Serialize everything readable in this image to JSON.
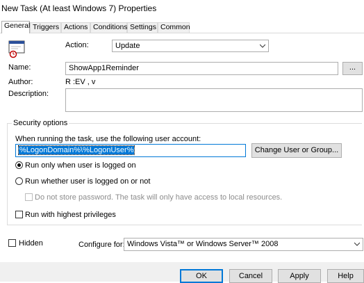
{
  "window": {
    "title": "New Task (At least Windows 7) Properties"
  },
  "tabs": [
    {
      "label": "General",
      "active": true
    },
    {
      "label": "Triggers"
    },
    {
      "label": "Actions"
    },
    {
      "label": "Conditions"
    },
    {
      "label": "Settings"
    },
    {
      "label": "Common"
    }
  ],
  "general": {
    "action_label": "Action:",
    "action_value": "Update",
    "name_label": "Name:",
    "name_value": "ShowApp1Reminder",
    "name_browse_label": "...",
    "author_label": "Author:",
    "author_value": "R          :EV     ,    v",
    "description_label": "Description:",
    "description_value": ""
  },
  "security": {
    "group_title": "Security options",
    "account_prompt": "When running the task, use the following user account:",
    "account_value": "%LogonDomain%\\%LogonUser%",
    "change_user_button": "Change User or Group...",
    "radio_logged_on": "Run only when user is logged on",
    "radio_logged_on_checked": true,
    "radio_whether": "Run whether user is logged on or not",
    "no_store_password": "Do not store password.  The task will only have access to local resources.",
    "highest_privileges": "Run with highest privileges"
  },
  "footer": {
    "hidden_label": "Hidden",
    "configure_label": "Configure for:",
    "configure_value": "Windows Vista™ or Windows Server™ 2008"
  },
  "buttons": {
    "ok": "OK",
    "cancel": "Cancel",
    "apply": "Apply",
    "help": "Help"
  },
  "colors": {
    "selection": "#0078d7",
    "button_face": "#e1e1e1",
    "dialog_face": "#f0f0f0"
  }
}
